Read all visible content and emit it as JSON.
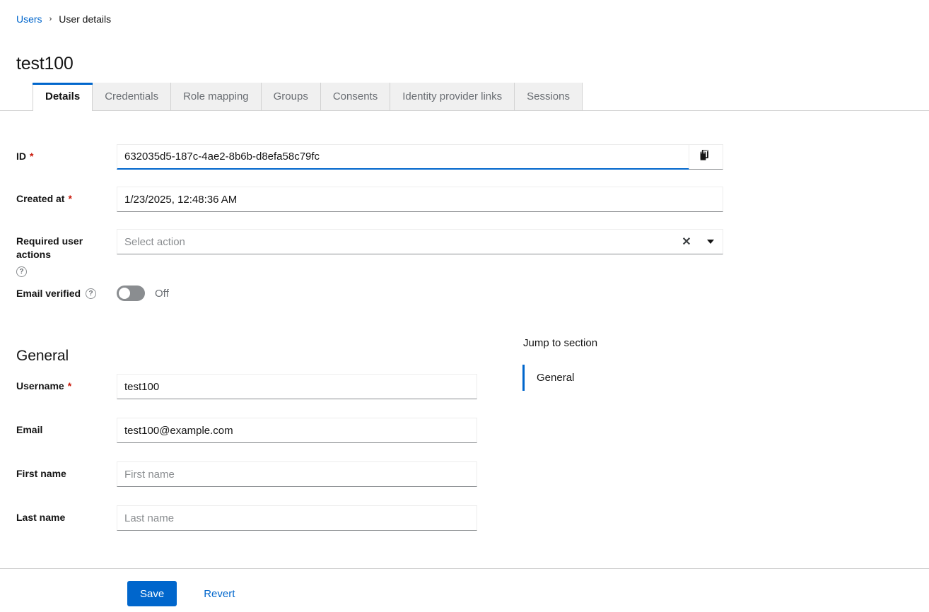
{
  "breadcrumb": {
    "parent_label": "Users",
    "separator": "›",
    "current_label": "User details"
  },
  "page_title": "test100",
  "tabs": [
    {
      "label": "Details",
      "active": true
    },
    {
      "label": "Credentials",
      "active": false
    },
    {
      "label": "Role mapping",
      "active": false
    },
    {
      "label": "Groups",
      "active": false
    },
    {
      "label": "Consents",
      "active": false
    },
    {
      "label": "Identity provider links",
      "active": false
    },
    {
      "label": "Sessions",
      "active": false
    }
  ],
  "form": {
    "id_field": {
      "label": "ID",
      "required_marker": "*",
      "value": "632035d5-187c-4ae2-8b6b-d8efa58c79fc",
      "copy_icon": "copy-icon"
    },
    "created_at": {
      "label": "Created at",
      "required_marker": "*",
      "value": "1/23/2025, 12:48:36 AM"
    },
    "required_user_actions": {
      "label": "Required user actions",
      "help_icon": "help-circle-icon",
      "placeholder": "Select action",
      "value": "",
      "clear_glyph": "✕",
      "toggle_icon": "chevron-down-icon"
    },
    "email_verified": {
      "label": "Email verified",
      "help_icon": "help-circle-icon",
      "state_label": "Off",
      "on": false
    }
  },
  "general_section": {
    "title": "General",
    "fields": [
      {
        "label": "Username",
        "required_marker": "*",
        "value": "test100",
        "placeholder": ""
      },
      {
        "label": "Email",
        "required_marker": "",
        "value": "test100@example.com",
        "placeholder": ""
      },
      {
        "label": "First name",
        "required_marker": "",
        "value": "",
        "placeholder": "First name"
      },
      {
        "label": "Last name",
        "required_marker": "",
        "value": "",
        "placeholder": "Last name"
      }
    ]
  },
  "jump_to_section": {
    "title": "Jump to section",
    "items": [
      {
        "label": "General",
        "active": true
      }
    ]
  },
  "footer": {
    "save_label": "Save",
    "revert_label": "Revert"
  },
  "colors": {
    "accent": "#0066cc",
    "required": "#c9190b",
    "muted": "#6a6e73",
    "border": "#d2d2d2",
    "toggle_off": "#8a8d90"
  }
}
